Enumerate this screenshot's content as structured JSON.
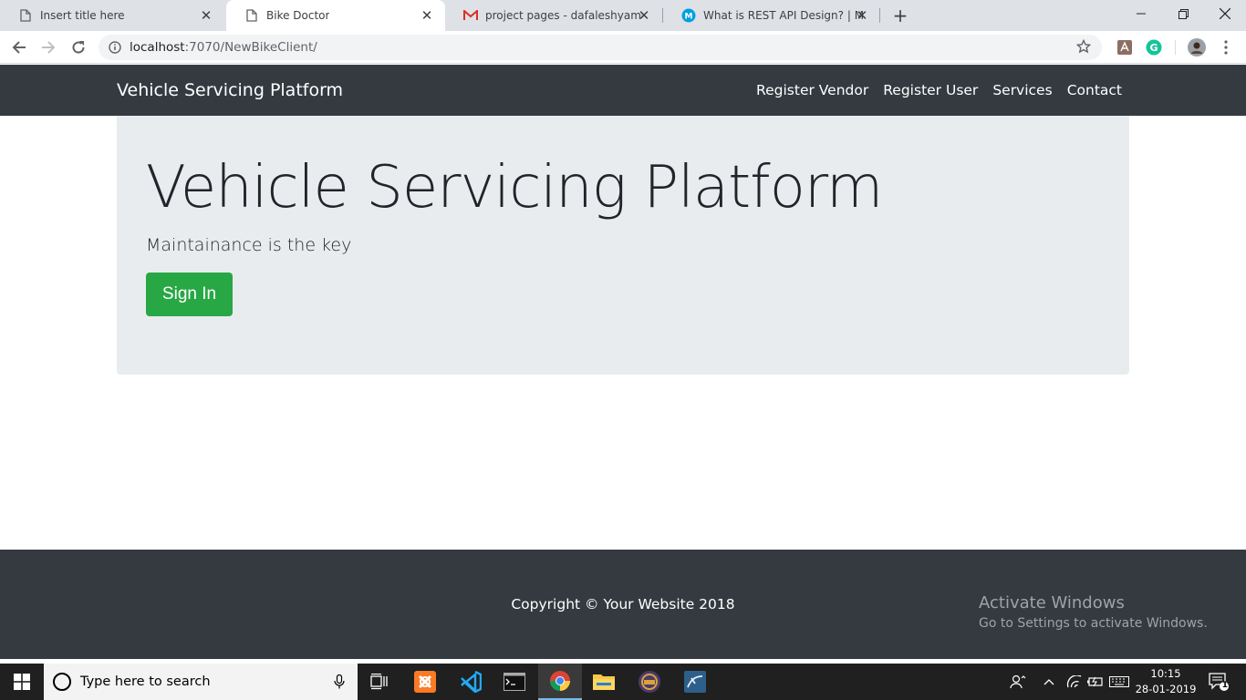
{
  "browser": {
    "tabs": [
      {
        "title": "Insert title here",
        "icon": "page-icon",
        "active": false
      },
      {
        "title": "Bike Doctor",
        "icon": "page-icon",
        "active": true
      },
      {
        "title": "project pages - dafaleshyam@gm",
        "icon": "gmail-icon",
        "active": false
      },
      {
        "title": "What is REST API Design? | MuleS",
        "icon": "mulesoft-icon",
        "active": false
      }
    ],
    "new_tab_label": "+",
    "url_host": "localhost",
    "url_rest": ":7070/NewBikeClient/"
  },
  "navbar": {
    "brand": "Vehicle Servicing Platform",
    "links": [
      "Register Vendor",
      "Register User",
      "Services",
      "Contact"
    ]
  },
  "jumbotron": {
    "title": "Vehicle Servicing Platform",
    "lead": "Maintainance is the key",
    "button": "Sign In"
  },
  "footer": {
    "copyright": "Copyright © Your Website 2018"
  },
  "watermark": {
    "line1": "Activate Windows",
    "line2": "Go to Settings to activate Windows."
  },
  "taskbar": {
    "search_placeholder": "Type here to search",
    "time": "10:15",
    "date": "28-01-2019",
    "notification_count": "1"
  },
  "colors": {
    "navbar_bg": "#343a40",
    "jumbotron_bg": "#e9ecef",
    "signin_bg": "#28a745",
    "taskbar_bg": "#202020"
  }
}
